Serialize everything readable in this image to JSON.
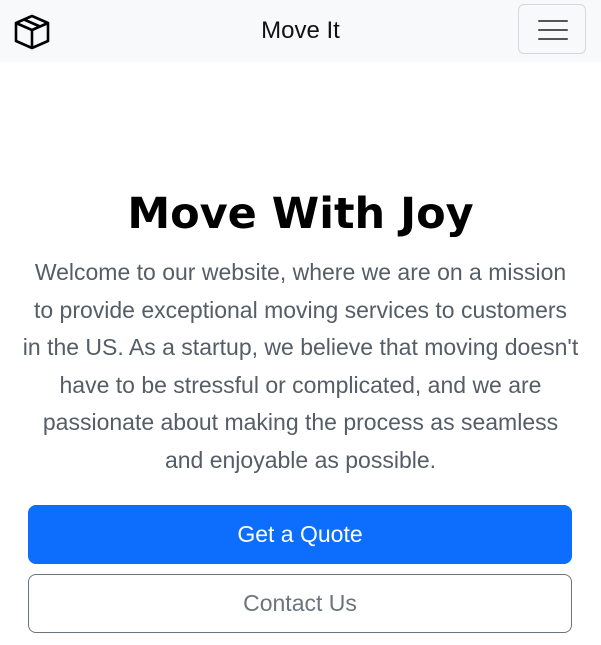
{
  "navbar": {
    "brand_icon": "box-icon",
    "title": "Move It",
    "toggler_icon": "hamburger-menu-icon"
  },
  "hero": {
    "heading": "Move With Joy",
    "description": "Welcome to our website, where we are on a mission to provide exceptional moving services to customers in the US. As a startup, we believe that moving doesn't have to be stressful or complicated, and we are passionate about making the process as seamless and enjoyable as possible."
  },
  "buttons": {
    "quote_label": "Get a Quote",
    "contact_label": "Contact Us"
  },
  "colors": {
    "navbar_bg": "#f8f9fa",
    "primary": "#0d6efd",
    "secondary": "#6c757d",
    "text_muted": "#555d66"
  }
}
